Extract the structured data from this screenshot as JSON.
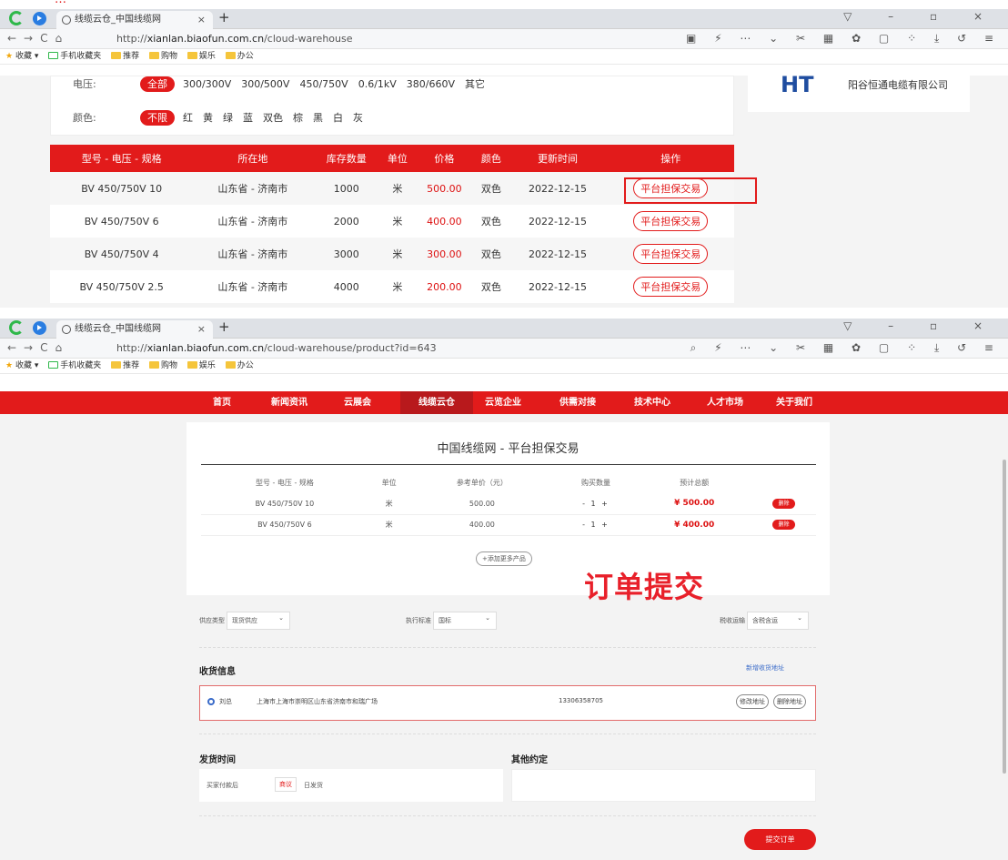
{
  "annotation_top": "…",
  "browser": {
    "tab_title": "线缆云仓_中国线缆网",
    "url1_prefix": "http://",
    "url1_host": "xianlan.biaofun.com.cn",
    "url1_path": "/cloud-warehouse",
    "url2_prefix": "http://",
    "url2_host": "xianlan.biaofun.com.cn",
    "url2_path": "/cloud-warehouse/product?id=643",
    "bookmarks": [
      "收藏",
      "手机收藏夹",
      "推荐",
      "购物",
      "娱乐",
      "办公"
    ]
  },
  "filters": {
    "voltage_label": "电压:",
    "voltage_active": "全部",
    "voltage_options": [
      "300/300V",
      "300/500V",
      "450/750V",
      "0.6/1kV",
      "380/660V",
      "其它"
    ],
    "color_label": "颜色:",
    "color_active": "不限",
    "color_options": [
      "红",
      "黄",
      "绿",
      "蓝",
      "双色",
      "棕",
      "黑",
      "白",
      "灰"
    ]
  },
  "supplier": {
    "logo": "HT",
    "company": "阳谷恒通电缆有限公司"
  },
  "stock_table": {
    "headers": [
      "型号 - 电压 - 规格",
      "所在地",
      "库存数量",
      "单位",
      "价格",
      "颜色",
      "更新时间",
      "操作"
    ],
    "rows": [
      [
        "BV 450/750V 10",
        "山东省 - 济南市",
        "1000",
        "米",
        "500.00",
        "双色",
        "2022-12-15",
        "平台担保交易"
      ],
      [
        "BV 450/750V 6",
        "山东省 - 济南市",
        "2000",
        "米",
        "400.00",
        "双色",
        "2022-12-15",
        "平台担保交易"
      ],
      [
        "BV 450/750V 4",
        "山东省 - 济南市",
        "3000",
        "米",
        "300.00",
        "双色",
        "2022-12-15",
        "平台担保交易"
      ],
      [
        "BV 450/750V 2.5",
        "山东省 - 济南市",
        "4000",
        "米",
        "200.00",
        "双色",
        "2022-12-15",
        "平台担保交易"
      ]
    ]
  },
  "main_nav": [
    "首页",
    "新闻资讯",
    "云展会",
    "线缆云仓",
    "云览企业",
    "供需对接",
    "技术中心",
    "人才市场",
    "关于我们"
  ],
  "main_nav_active": "线缆云仓",
  "order": {
    "title": "中国线缆网 - 平台担保交易",
    "headers": [
      "型号 - 电压 - 规格",
      "单位",
      "参考单价（元）",
      "购买数量",
      "预计总额",
      ""
    ],
    "rows": [
      {
        "model": "BV 450/750V 10",
        "unit": "米",
        "price": "500.00",
        "qty": "1",
        "total": "¥ 500.00",
        "del": "删除"
      },
      {
        "model": "BV 450/750V 6",
        "unit": "米",
        "price": "400.00",
        "qty": "1",
        "total": "¥ 400.00",
        "del": "删除"
      }
    ],
    "add_more": "+添加更多产品",
    "overlay": "订单提交",
    "supply_type_label": "供应类型",
    "supply_type": "现货供应",
    "standard_label": "执行标准",
    "standard": "国标",
    "tax_label": "税收运输",
    "tax": "含税含运",
    "receive_title": "收货信息",
    "new_address": "新增收货地址",
    "addr_name": "刘总",
    "addr_text": "上海市上海市崇明区山东省济南市和瑞广场",
    "addr_phone": "13306358705",
    "edit_addr": "修改地址",
    "del_addr": "删除地址",
    "ship_title": "发货时间",
    "ship_prefix": "买家付款后",
    "ship_sel": "商议",
    "ship_suffix": "日发货",
    "other_title": "其他约定",
    "submit": "提交订单"
  }
}
